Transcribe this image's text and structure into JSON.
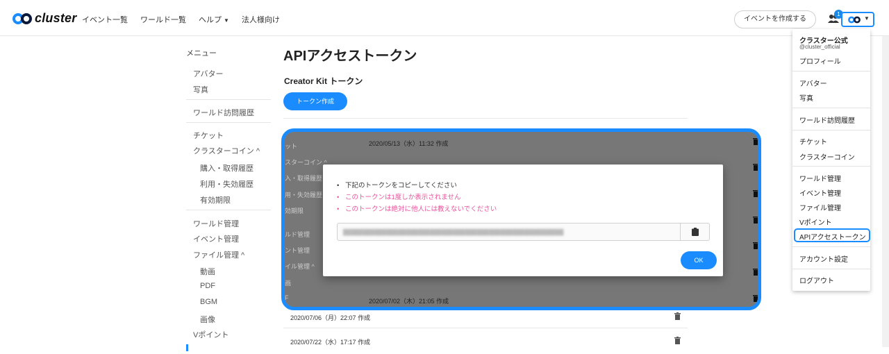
{
  "header": {
    "logo_text": "cluster",
    "nav": [
      {
        "label": "イベント一覧"
      },
      {
        "label": "ワールド一覧"
      },
      {
        "label": "ヘルプ"
      },
      {
        "label": "法人様向け"
      }
    ],
    "create_event_label": "イベントを作成する",
    "notification_count": "1"
  },
  "menu": {
    "heading": "メニュー",
    "items": [
      {
        "label": "アバター"
      },
      {
        "label": "写真"
      },
      {
        "label": "ワールド訪問履歴"
      },
      {
        "label": "チケット"
      },
      {
        "label": "クラスターコイン ^"
      },
      {
        "label": "購入・取得履歴"
      },
      {
        "label": "利用・失効履歴"
      },
      {
        "label": "有効期限"
      },
      {
        "label": "ワールド管理"
      },
      {
        "label": "イベント管理"
      },
      {
        "label": "ファイル管理 ^"
      },
      {
        "label": "動画"
      },
      {
        "label": "PDF"
      },
      {
        "label": "BGM"
      },
      {
        "label": "画像"
      },
      {
        "label": "Vポイント"
      }
    ]
  },
  "main": {
    "title": "APIアクセストークン",
    "subtitle": "Creator Kit トークン",
    "create_token_label": "トークン作成",
    "rows": [
      {
        "date": "2020/07/06（月）22:07 作成"
      },
      {
        "date": "2020/07/22（水）17:17 作成"
      }
    ]
  },
  "overlay": {
    "side_texts": [
      "ット",
      "スターコイン ^",
      "入・取得履歴",
      "用・失効履歴",
      "効期限",
      "ルド管理",
      "ント管理",
      "イル管理 ^",
      "画",
      "F"
    ],
    "dates": [
      "2020/05/13（水）11:32 作成",
      "2020/07/02（木）21:05 作成"
    ],
    "modal": {
      "instruction": "下記のトークンをコピーしてください",
      "warning1": "このトークンは1度しか表示されません",
      "warning2": "このトークンは絶対に他人には教えないでください",
      "ok_label": "OK"
    }
  },
  "account_dropdown": {
    "user_name": "クラスター公式",
    "user_handle": "@cluster_official",
    "profile": "プロフィール",
    "avatar": "アバター",
    "photos": "写真",
    "world_history": "ワールド訪問履歴",
    "tickets": "チケット",
    "coins": "クラスターコイン",
    "world_manage": "ワールド管理",
    "event_manage": "イベント管理",
    "file_manage": "ファイル管理",
    "vpoint": "Vポイント",
    "api_token": "APIアクセストークン",
    "account_settings": "アカウント設定",
    "logout": "ログアウト"
  },
  "colors": {
    "accent": "#1a8cff",
    "warning": "#e8539a"
  }
}
